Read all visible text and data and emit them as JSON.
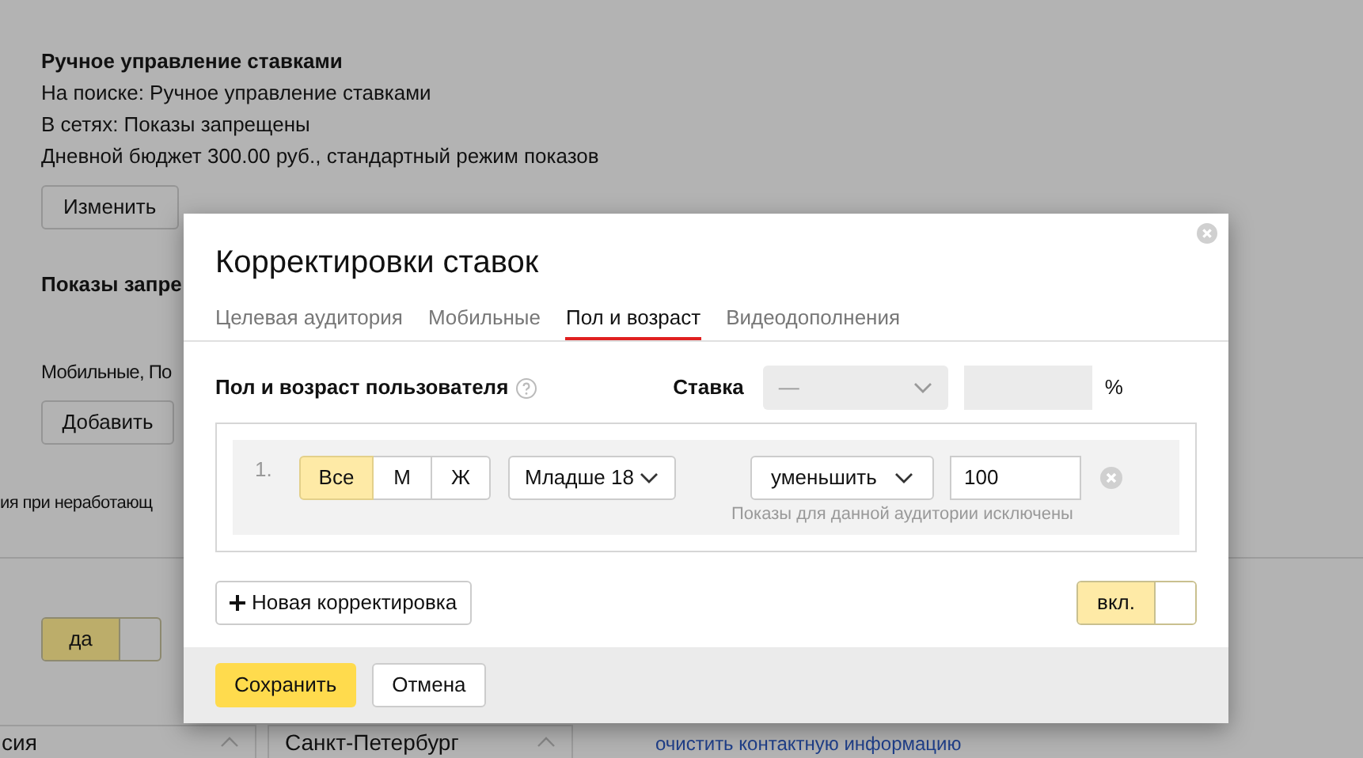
{
  "background": {
    "heading": "Ручное управление ставками",
    "lines": [
      "На поиске: Ручное управление ставками",
      "В сетях: Показы запрещены",
      "Дневной бюджет 300.00 руб., стандартный режим показов"
    ],
    "edit_button": "Изменить",
    "section_heading": "Показы запре",
    "section_text": "Мобильные, По",
    "add_button": "Добавить",
    "cut_text": "ия при неработающ",
    "toggle": {
      "label": "да",
      "on": true
    },
    "fields": [
      {
        "value": "сия"
      },
      {
        "value": "Санкт-Петербург"
      }
    ],
    "link": "очистить контактную информацию"
  },
  "dialog": {
    "title": "Корректировки ставок",
    "tabs": [
      {
        "label": "Целевая аудитория",
        "selected": false
      },
      {
        "label": "Мобильные",
        "selected": false
      },
      {
        "label": "Пол и возраст",
        "selected": true
      },
      {
        "label": "Видеодополнения",
        "selected": false
      }
    ],
    "targeting_label": "Пол и возраст пользователя",
    "rate_label": "Ставка",
    "rate_select": {
      "placeholder": "—",
      "disabled": true
    },
    "percent": "%",
    "adjustments": [
      {
        "number": "1.",
        "gender_options": [
          {
            "label": "Все",
            "selected": true
          },
          {
            "label": "М",
            "selected": false
          },
          {
            "label": "Ж",
            "selected": false
          }
        ],
        "age": "Младше 18",
        "action": "уменьшить",
        "value": "100",
        "hint": "Показы для данной аудитории исключены"
      }
    ],
    "add_button": "Новая корректировка",
    "enabled_toggle": {
      "label": "вкл.",
      "on": true
    },
    "buttons": [
      {
        "label": "Сохранить",
        "kind": "primary"
      },
      {
        "label": "Отмена",
        "kind": "secondary"
      }
    ]
  }
}
